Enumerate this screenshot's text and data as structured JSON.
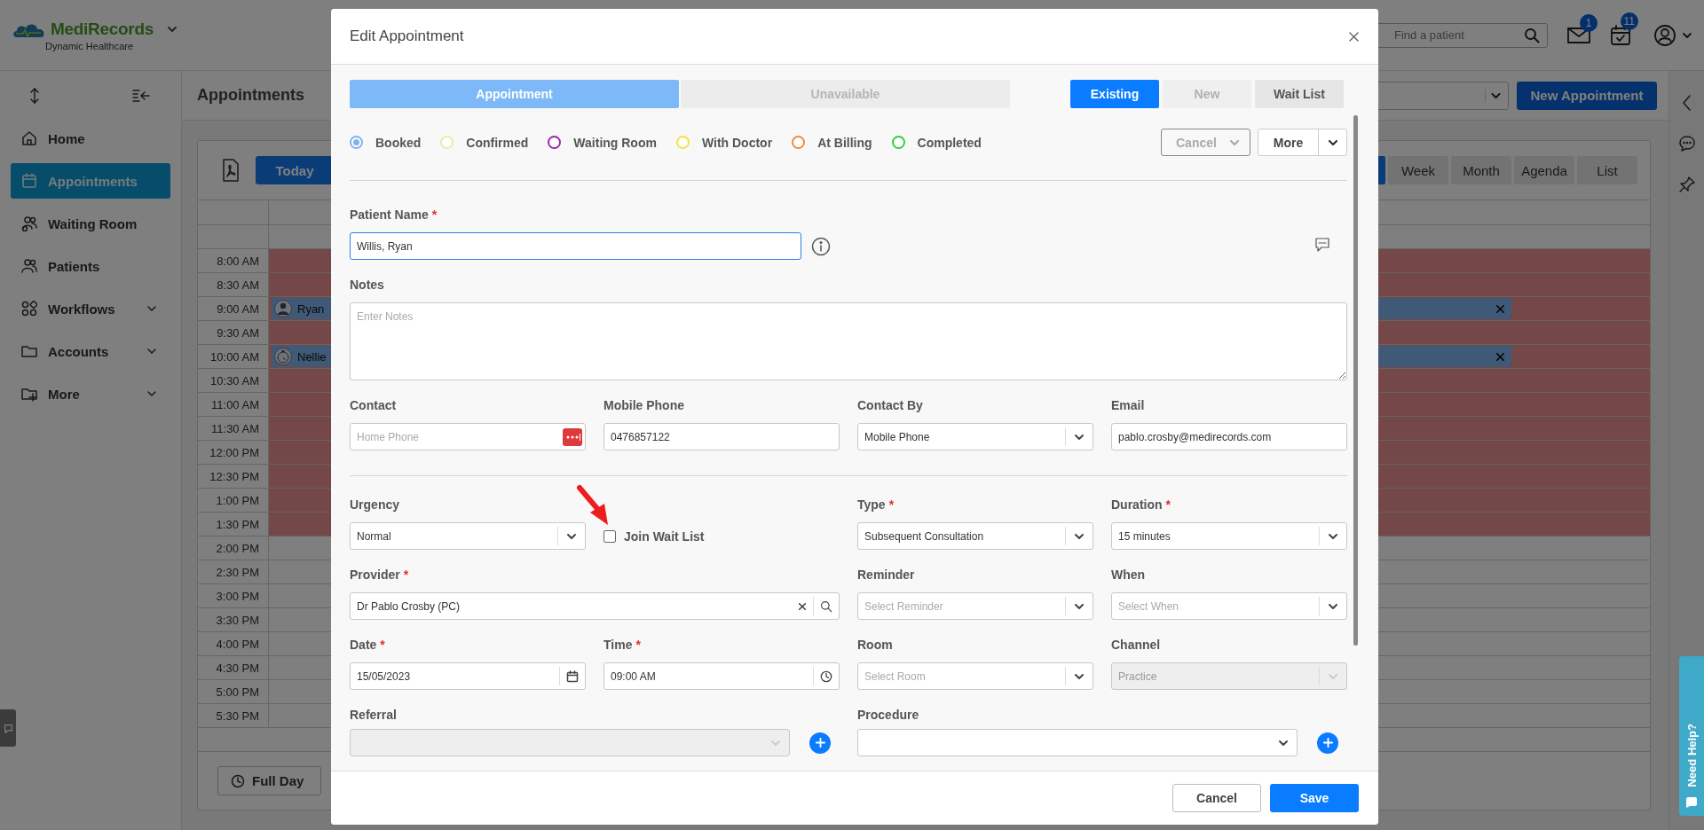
{
  "app": {
    "brand": "MediRecords",
    "subtitle": "Dynamic Healthcare"
  },
  "header": {
    "search_placeholder": "Find a patient",
    "mail_badge": "1",
    "tasks_badge": "11"
  },
  "sidebar": {
    "items": [
      {
        "label": "Home",
        "selected": false,
        "expandable": false
      },
      {
        "label": "Appointments",
        "selected": true,
        "expandable": false
      },
      {
        "label": "Waiting Room",
        "selected": false,
        "expandable": false
      },
      {
        "label": "Patients",
        "selected": false,
        "expandable": false
      },
      {
        "label": "Workflows",
        "selected": false,
        "expandable": true
      },
      {
        "label": "Accounts",
        "selected": false,
        "expandable": true
      },
      {
        "label": "More",
        "selected": false,
        "expandable": true
      }
    ]
  },
  "page": {
    "title": "Appointments",
    "new_button": "New Appointment",
    "today_button": "Today",
    "full_day_button": "Full Day",
    "views": [
      {
        "selected": true
      },
      {
        "label": "Week",
        "selected": false
      },
      {
        "label": "Month",
        "selected": false
      },
      {
        "label": "Agenda",
        "selected": false
      },
      {
        "label": "List",
        "selected": false
      }
    ]
  },
  "schedule": {
    "slots": [
      {
        "time": "8:00 AM",
        "unavailable": true
      },
      {
        "time": "8:30 AM",
        "unavailable": true
      },
      {
        "time": "9:00 AM",
        "unavailable": true,
        "event": {
          "name": "Ryan",
          "kind": "with-doctor"
        }
      },
      {
        "time": "9:30 AM",
        "unavailable": true
      },
      {
        "time": "10:00 AM",
        "unavailable": true,
        "event": {
          "name": "Nellie",
          "kind": "waiting"
        }
      },
      {
        "time": "10:30 AM",
        "unavailable": true
      },
      {
        "time": "11:00 AM",
        "unavailable": true
      },
      {
        "time": "11:30 AM",
        "unavailable": true
      },
      {
        "time": "12:00 PM",
        "unavailable": true
      },
      {
        "time": "12:30 PM",
        "unavailable": true
      },
      {
        "time": "1:00 PM",
        "unavailable": true
      },
      {
        "time": "1:30 PM",
        "unavailable": true
      },
      {
        "time": "2:00 PM",
        "unavailable": false
      },
      {
        "time": "2:30 PM",
        "unavailable": false
      },
      {
        "time": "3:00 PM",
        "unavailable": false
      },
      {
        "time": "3:30 PM",
        "unavailable": false
      },
      {
        "time": "4:00 PM",
        "unavailable": false
      },
      {
        "time": "4:30 PM",
        "unavailable": false
      },
      {
        "time": "5:00 PM",
        "unavailable": false
      },
      {
        "time": "5:30 PM",
        "unavailable": false
      }
    ]
  },
  "help_tab": "Need Help?",
  "modal": {
    "title": "Edit Appointment",
    "mode_tabs": [
      {
        "label": "Appointment",
        "selected": true
      },
      {
        "label": "Unavailable",
        "selected": false
      }
    ],
    "patient_tabs": [
      {
        "label": "Existing",
        "selected": true,
        "disabled": false
      },
      {
        "label": "New",
        "selected": false,
        "disabled": true
      },
      {
        "label": "Wait List",
        "selected": false,
        "disabled": false
      }
    ],
    "statuses": [
      {
        "label": "Booked",
        "selected": true,
        "color": "#7fb3ea"
      },
      {
        "label": "Confirmed",
        "selected": false,
        "color": "#d8f5a0"
      },
      {
        "label": "Waiting Room",
        "selected": false,
        "color": "#9b27b0"
      },
      {
        "label": "With Doctor",
        "selected": false,
        "color": "#f5e23a"
      },
      {
        "label": "At Billing",
        "selected": false,
        "color": "#f28a3c"
      },
      {
        "label": "Completed",
        "selected": false,
        "color": "#2fd13f"
      }
    ],
    "cancel_menu": {
      "label": "Cancel",
      "disabled": true
    },
    "more_menu": {
      "label": "More"
    },
    "patient_name": {
      "label": "Patient Name",
      "required_mark": "*",
      "value": "Willis, Ryan"
    },
    "notes": {
      "label": "Notes",
      "placeholder": "Enter Notes"
    },
    "contact": {
      "label": "Contact",
      "placeholder": "Home Phone"
    },
    "mobile_phone": {
      "label": "Mobile Phone",
      "value": "0476857122"
    },
    "contact_by": {
      "label": "Contact By",
      "value": "Mobile Phone"
    },
    "email": {
      "label": "Email",
      "value": "pablo.crosby@medirecords.com"
    },
    "urgency": {
      "label": "Urgency",
      "value": "Normal"
    },
    "join_wait_list": {
      "label": "Join Wait List",
      "checked": false
    },
    "type": {
      "label": "Type",
      "required_mark": "*",
      "value": "Subsequent Consultation"
    },
    "duration": {
      "label": "Duration",
      "required_mark": "*",
      "value": "15 minutes"
    },
    "provider": {
      "label": "Provider",
      "required_mark": "*",
      "value": "Dr Pablo Crosby (PC)"
    },
    "reminder": {
      "label": "Reminder",
      "placeholder": "Select Reminder"
    },
    "when": {
      "label": "When",
      "placeholder": "Select When"
    },
    "date": {
      "label": "Date",
      "required_mark": "*",
      "value": "15/05/2023"
    },
    "time": {
      "label": "Time",
      "required_mark": "*",
      "value": "09:00 AM"
    },
    "room": {
      "label": "Room",
      "placeholder": "Select Room"
    },
    "channel": {
      "label": "Channel",
      "value": "Practice",
      "disabled": true
    },
    "referral": {
      "label": "Referral",
      "disabled": true
    },
    "procedure": {
      "label": "Procedure",
      "disabled": false
    },
    "footer_buttons": [
      {
        "label": "Cancel",
        "kind": "secondary"
      },
      {
        "label": "Save",
        "kind": "primary"
      }
    ]
  }
}
